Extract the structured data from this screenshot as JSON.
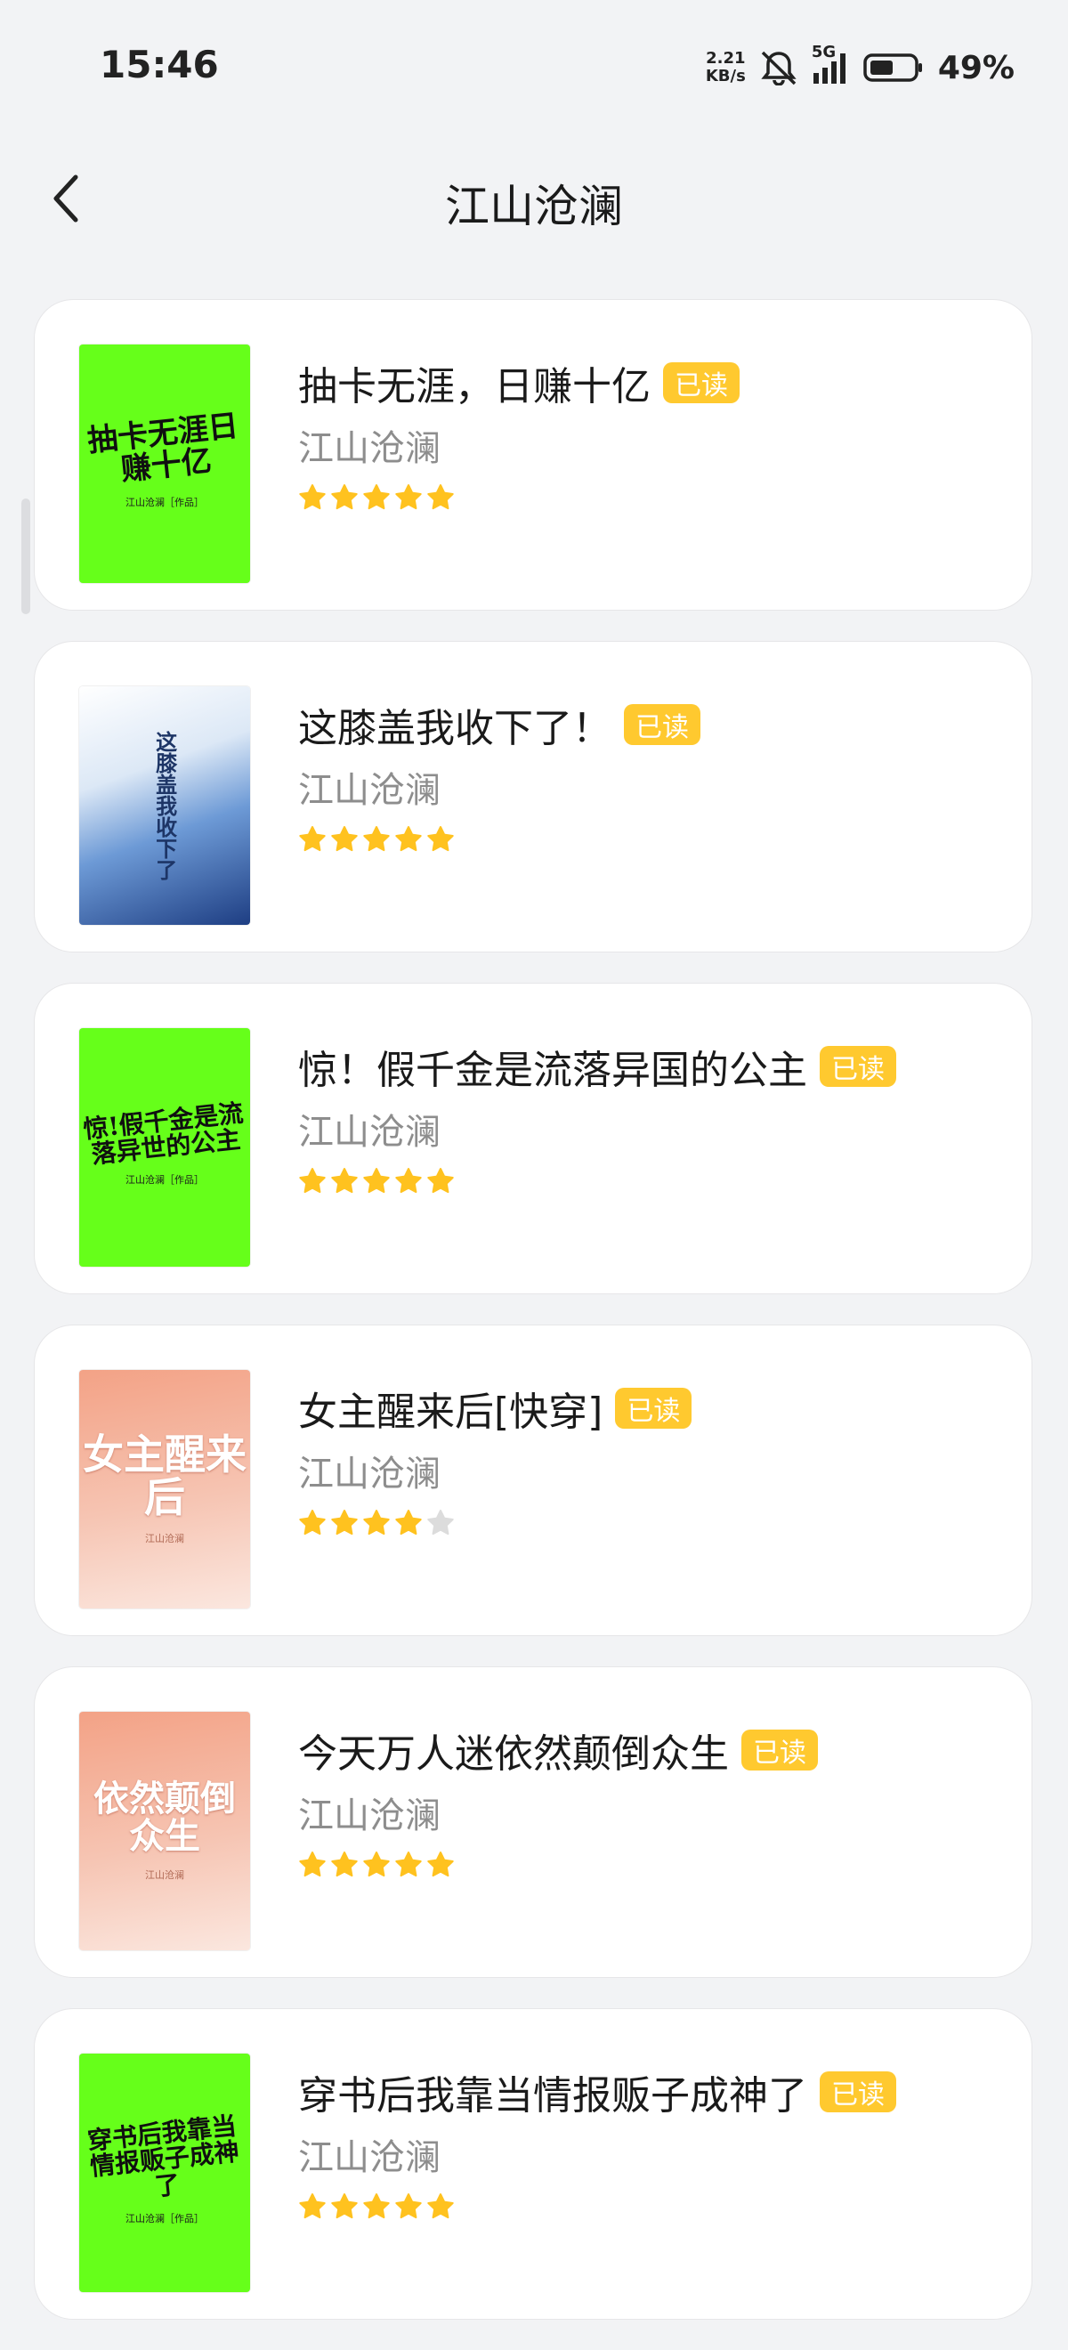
{
  "status_bar": {
    "time": "15:46",
    "net_speed_value": "2.21",
    "net_speed_unit": "KB/s",
    "network_type": "5G",
    "battery_percent": "49%"
  },
  "header": {
    "title": "江山沧澜",
    "back_icon": "chevron-left-icon"
  },
  "colors": {
    "badge": "#ffc92f",
    "star_filled": "#ffc21f",
    "star_empty": "#dcdcdc",
    "cover_green": "#66ff1a"
  },
  "books": [
    {
      "title": "抽卡无涯，日赚十亿",
      "badge": "已读",
      "author": "江山沧澜",
      "rating": 5,
      "cover": {
        "style": "green",
        "text": "抽卡无涯日赚十亿",
        "sub": "江山沧澜［作品］"
      }
    },
    {
      "title": "这膝盖我收下了！",
      "badge": "已读",
      "author": "江山沧澜",
      "rating": 5,
      "cover": {
        "style": "blue",
        "text": "这膝盖我收下了",
        "sub": ""
      }
    },
    {
      "title": "惊！假千金是流落异国的公主",
      "badge": "已读",
      "author": "江山沧澜",
      "rating": 5,
      "cover": {
        "style": "green",
        "text": "惊!假千金是流落异世的公主",
        "sub": "江山沧澜［作品］"
      }
    },
    {
      "title": "女主醒来后[快穿]",
      "badge": "已读",
      "author": "江山沧澜",
      "rating": 4,
      "cover": {
        "style": "pink",
        "text": "女主醒来后",
        "sub": "江山沧澜"
      }
    },
    {
      "title": "今天万人迷依然颠倒众生",
      "badge": "已读",
      "author": "江山沧澜",
      "rating": 5,
      "cover": {
        "style": "pink",
        "text": "依然颠倒众生",
        "sub": "江山沧澜"
      }
    },
    {
      "title": "穿书后我靠当情报贩子成神了",
      "badge": "已读",
      "author": "江山沧澜",
      "rating": 5,
      "cover": {
        "style": "green",
        "text": "穿书后我靠当情报贩子成神了",
        "sub": "江山沧澜［作品］"
      }
    }
  ]
}
